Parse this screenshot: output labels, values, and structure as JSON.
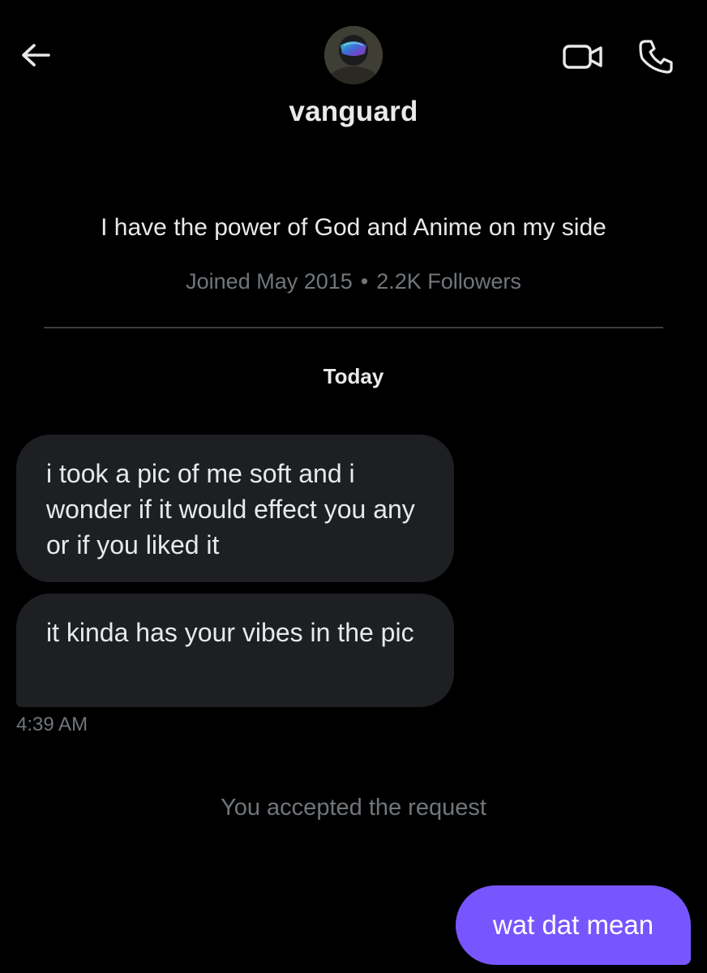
{
  "header": {
    "back_icon": "arrow-left-icon",
    "video_icon": "video-camera-icon",
    "call_icon": "phone-icon",
    "username": "vanguard"
  },
  "profile": {
    "bio": "I have the power of God and Anime on my side",
    "joined": "Joined May 2015",
    "separator": "•",
    "followers": "2.2K Followers"
  },
  "conversation": {
    "day_label": "Today",
    "incoming": [
      {
        "text": "i took a pic of me soft and i wonder if it would effect you any or if you liked it"
      },
      {
        "text": "it kinda has your vibes in the pic"
      }
    ],
    "incoming_time": "4:39 AM",
    "system_message": "You accepted the request",
    "outgoing": [
      {
        "text": "wat dat mean"
      }
    ]
  },
  "colors": {
    "background": "#000000",
    "incoming_bubble": "#1d1f23",
    "outgoing_bubble": "#7856ff",
    "secondary_text": "#71767b",
    "primary_text": "#e7e9ea"
  }
}
